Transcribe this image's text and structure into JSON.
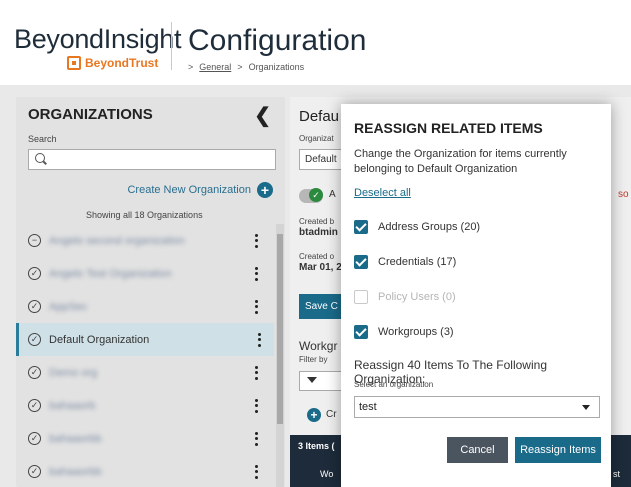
{
  "header": {
    "brand": "BeyondInsight",
    "logo_text": "BeyondTrust",
    "page_title": "Configuration",
    "breadcrumb": [
      ">",
      "General",
      ">",
      "Organizations"
    ]
  },
  "left_panel": {
    "heading": "ORGANIZATIONS",
    "search_label": "Search",
    "search_placeholder": "",
    "create_label": "Create New Organization",
    "showing": "Showing all 18 Organizations",
    "organizations": [
      {
        "name": "Angelo second organization",
        "status_icon": "minus-circle",
        "blurred": true,
        "selected": false
      },
      {
        "name": "Angelo Test Organization",
        "status_icon": "check-circle",
        "blurred": true,
        "selected": false
      },
      {
        "name": "AppSec",
        "status_icon": "check-circle",
        "blurred": true,
        "selected": false
      },
      {
        "name": "Default Organization",
        "status_icon": "check-circle",
        "blurred": false,
        "selected": true
      },
      {
        "name": "Demo org",
        "status_icon": "check-circle",
        "blurred": true,
        "selected": false
      },
      {
        "name": "bahaaorb",
        "status_icon": "check-circle",
        "blurred": true,
        "selected": false
      },
      {
        "name": "bahaaorbb",
        "status_icon": "check-circle",
        "blurred": true,
        "selected": false
      },
      {
        "name": "bahaaorbb",
        "status_icon": "check-circle",
        "blurred": true,
        "selected": false
      }
    ]
  },
  "detail": {
    "title": "Defau",
    "org_label": "Organizat",
    "org_value": "Default",
    "toggle_text": "A",
    "red_text": "so",
    "created_by_label": "Created b",
    "created_by_value": "btadmin",
    "created_on_label": "Created o",
    "created_on_value": "Mar 01, 2",
    "save_label": "Save C",
    "workgroups_title": "Workgr",
    "filter_label": "Filter by",
    "create_text": "Cr",
    "items_text": "3 Items (",
    "items_col": "Wo",
    "items_last": "st"
  },
  "modal": {
    "title": "REASSIGN RELATED ITEMS",
    "description": "Change the Organization for items currently belonging to Default Organization",
    "deselect_all": "Deselect all",
    "items": [
      {
        "label": "Address Groups (20)",
        "checked": true,
        "disabled": false
      },
      {
        "label": "Credentials (17)",
        "checked": true,
        "disabled": false
      },
      {
        "label": "Policy Users (0)",
        "checked": false,
        "disabled": true
      },
      {
        "label": "Workgroups (3)",
        "checked": true,
        "disabled": false
      }
    ],
    "reassign_heading": "Reassign 40 Items To The Following Organization:",
    "select_label": "Select an organization",
    "select_value": "test",
    "cancel_label": "Cancel",
    "reassign_label": "Reassign Items"
  },
  "colors": {
    "accent": "#1a6a8a",
    "brand_orange": "#e87722",
    "cancel": "#4b5560",
    "dark_bar": "#1d2b3a"
  }
}
